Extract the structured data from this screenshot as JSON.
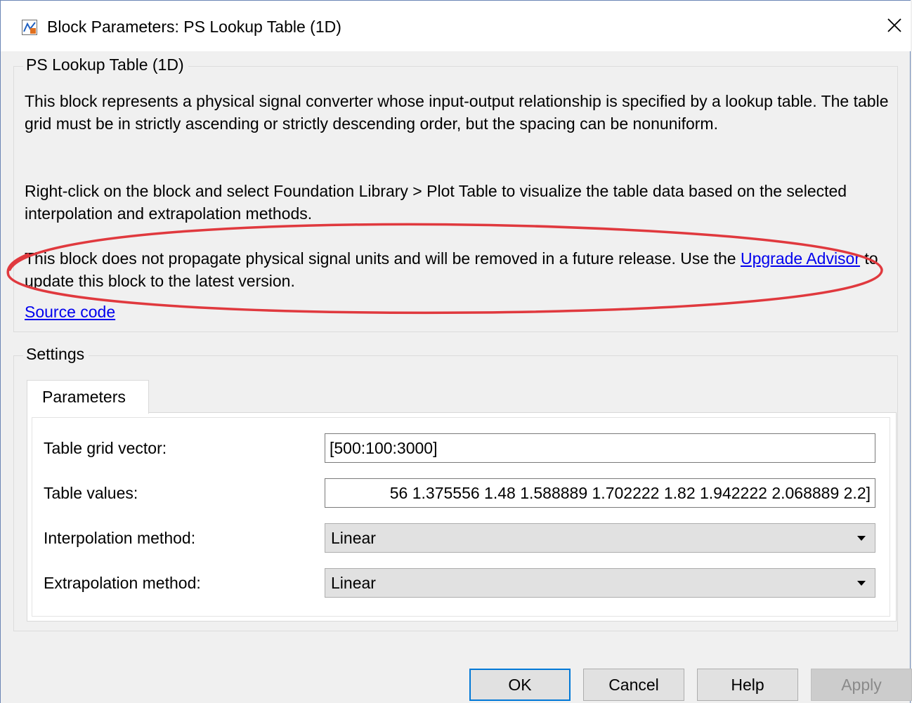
{
  "window": {
    "title": "Block Parameters: PS Lookup Table (1D)"
  },
  "description_group": {
    "legend": "PS Lookup Table (1D)",
    "paragraph1": "This block represents a physical signal converter whose input-output relationship is specified by a lookup table. The table grid must be in strictly ascending or strictly descending order, but the spacing can be nonuniform.",
    "paragraph2": "Right-click on the block and select Foundation Library > Plot Table to visualize the table data based on the selected interpolation and extrapolation methods.",
    "paragraph3_before": "This block does not propagate physical signal units and will be removed in a future release. Use the ",
    "paragraph3_link": "Upgrade Advisor",
    "paragraph3_after": " to update this block to the latest version.",
    "source_code_link": "Source code"
  },
  "settings_group": {
    "legend": "Settings",
    "tab_label": "Parameters",
    "parameters": {
      "table_grid_vector": {
        "label": "Table grid vector:",
        "value": "[500:100:3000]"
      },
      "table_values": {
        "label": "Table values:",
        "value": "56 1.375556 1.48 1.588889 1.702222 1.82 1.942222 2.068889 2.2]"
      },
      "interpolation_method": {
        "label": "Interpolation method:",
        "value": "Linear"
      },
      "extrapolation_method": {
        "label": "Extrapolation method:",
        "value": "Linear"
      }
    }
  },
  "buttons": {
    "ok": "OK",
    "cancel": "Cancel",
    "help": "Help",
    "apply": "Apply"
  },
  "colors": {
    "annotation_ellipse": "#e0393e",
    "link": "#0000ee",
    "primary_button_border": "#0078d7"
  },
  "icons": {
    "app": "simulink-block-icon",
    "close": "close-icon",
    "dropdown": "chevron-down-icon"
  }
}
